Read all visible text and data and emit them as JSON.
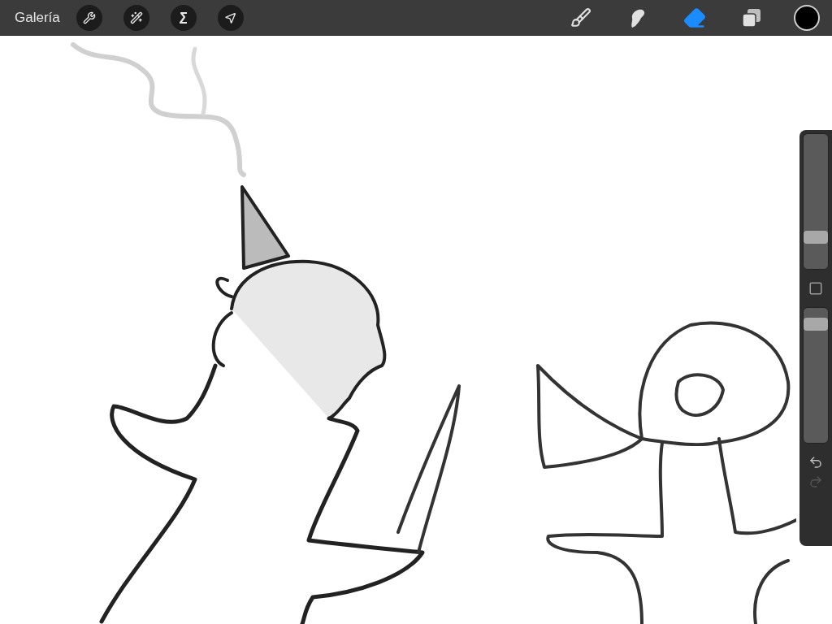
{
  "toolbar": {
    "gallery": "Galería",
    "left_tools": [
      {
        "kind": "adjust",
        "selected": false
      },
      {
        "kind": "wand",
        "selected": false
      },
      {
        "kind": "selection",
        "selected": false
      },
      {
        "kind": "transform",
        "selected": false
      }
    ],
    "right_tools": [
      {
        "kind": "brush",
        "selected": false
      },
      {
        "kind": "smudge",
        "selected": false
      },
      {
        "kind": "eraser",
        "selected": true
      },
      {
        "kind": "layers",
        "selected": false
      }
    ],
    "color": "#000000"
  },
  "sidebar": {
    "size": {
      "level": 0.22
    },
    "opacity": {
      "level": 0.92
    },
    "undo": {
      "disabled": false
    },
    "redo": {
      "disabled": true
    }
  }
}
